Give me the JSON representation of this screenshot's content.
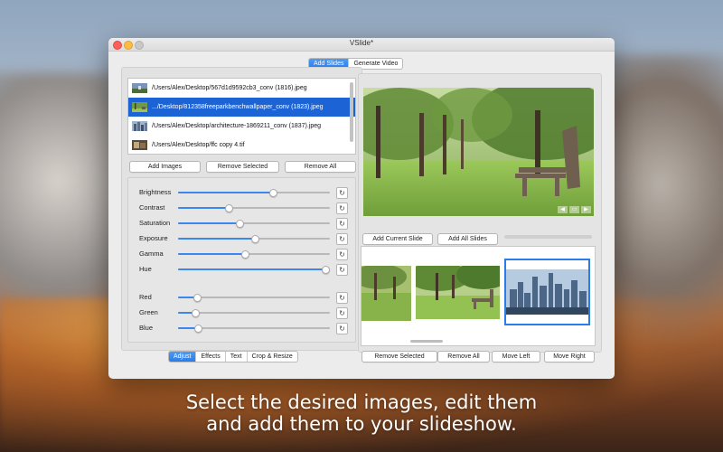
{
  "window": {
    "title": "VSlide*"
  },
  "top_tabs": [
    {
      "label": "Add Slides",
      "active": true
    },
    {
      "label": "Generate Video",
      "active": false
    }
  ],
  "files": [
    {
      "path": "/Users/Alex/Desktop/567d1d9592cb3_conv (1816).jpeg",
      "selected": false
    },
    {
      "path": ".../Desktop/812358freeparkbenchwallpaper_conv (1823).jpeg",
      "selected": true
    },
    {
      "path": "/Users/Alex/Desktop/architecture-1869211_conv (1837).jpeg",
      "selected": false
    },
    {
      "path": "/Users/Alex/Desktop/ffc copy 4.tif",
      "selected": false
    }
  ],
  "file_buttons": {
    "add": "Add Images",
    "remove_selected": "Remove Selected",
    "remove_all": "Remove All"
  },
  "adjustments": [
    {
      "label": "Brightness",
      "value": 0.62
    },
    {
      "label": "Contrast",
      "value": 0.33
    },
    {
      "label": "Saturation",
      "value": 0.4
    },
    {
      "label": "Exposure",
      "value": 0.5
    },
    {
      "label": "Gamma",
      "value": 0.44
    },
    {
      "label": "Hue",
      "value": 0.97
    },
    {
      "label": "Red",
      "value": 0.12
    },
    {
      "label": "Green",
      "value": 0.11
    },
    {
      "label": "Blue",
      "value": 0.13
    }
  ],
  "edit_tabs": [
    {
      "label": "Adjust",
      "active": true
    },
    {
      "label": "Effects",
      "active": false
    },
    {
      "label": "Text",
      "active": false
    },
    {
      "label": "Crop & Resize",
      "active": false
    }
  ],
  "slide_buttons": {
    "add_current": "Add Current Slide",
    "add_all": "Add All Slides"
  },
  "strip_buttons": {
    "remove_selected": "Remove Selected",
    "remove_all": "Remove All",
    "move_left": "Move Left",
    "move_right": "Move Right"
  },
  "caption": {
    "line1": "Select the desired images, edit them",
    "line2": "and add them to your slideshow."
  },
  "colors": {
    "accent": "#2a7ce8",
    "selection": "#1c64d6",
    "slider_fill": "#3d86f0"
  },
  "icons": {
    "reset": "reset-icon",
    "prev": "prev-arrow-icon",
    "next": "next-arrow-icon"
  }
}
